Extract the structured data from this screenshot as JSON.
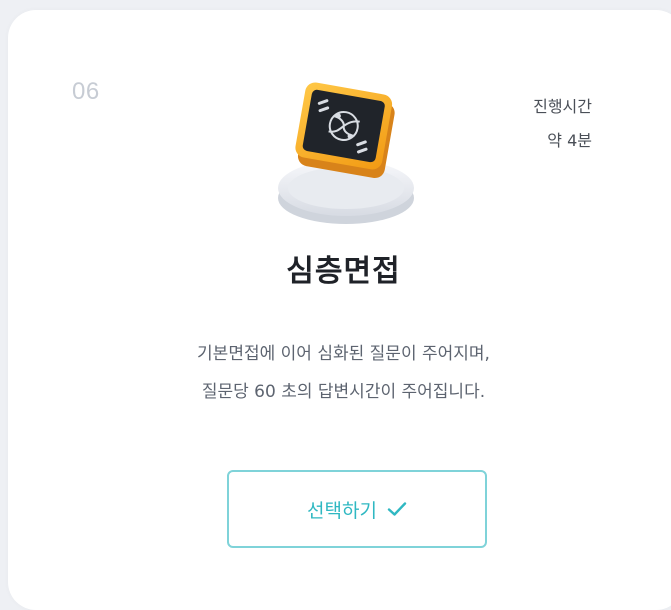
{
  "card": {
    "step_number": "06",
    "duration_label": "진행시간",
    "duration_value": "약 4분",
    "title": "심층면접",
    "description_line1": "기본면접에 이어 심화된 질문이 주어지며,",
    "description_line2": "질문당 60 초의 답변시간이 주어집니다.",
    "button_label": "선택하기",
    "icons": {
      "illustration": "interview-monitor-icon",
      "button": "check-icon"
    },
    "colors": {
      "accent": "#2fb8c2",
      "button_border": "#7fd3d9",
      "monitor_frame": "#f5a11c",
      "monitor_screen": "#1f2328"
    }
  }
}
